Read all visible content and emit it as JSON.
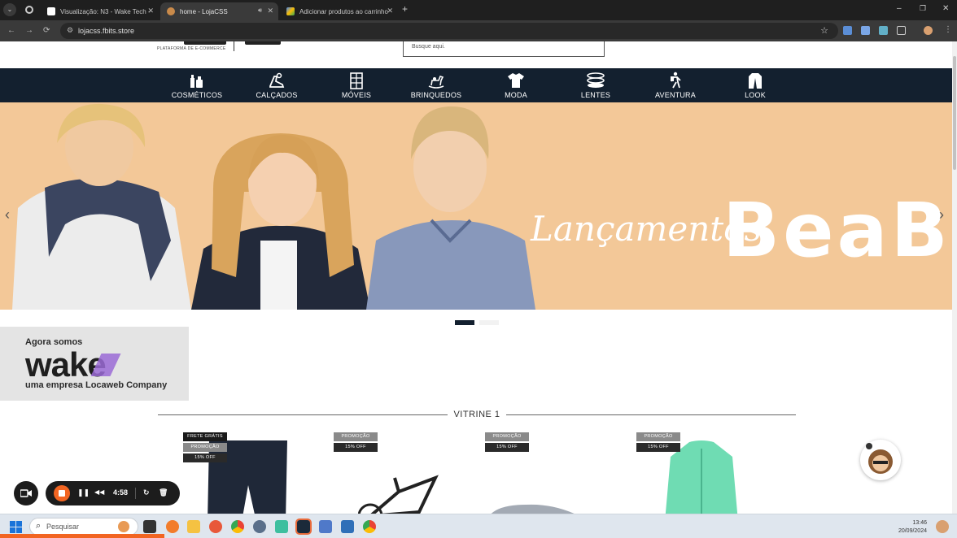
{
  "browser": {
    "tabs": [
      {
        "title": "Visualização: N3 - Wake Tech -",
        "active": false
      },
      {
        "title": "home - LojaCSS",
        "active": true
      },
      {
        "title": "Adicionar produtos ao carrinho",
        "active": false
      }
    ],
    "new_tab": "+",
    "address": "lojacss.fbits.store",
    "window_controls": [
      "–",
      "❐",
      "✕"
    ]
  },
  "page": {
    "logo_subtitle": "PLATAFORMA DE E-COMMERCE",
    "search_placeholder": "Busque aqui.",
    "categories": [
      {
        "label": "COSMÉTICOS",
        "icon": "cosmetics-icon"
      },
      {
        "label": "CALÇADOS",
        "icon": "shoe-icon"
      },
      {
        "label": "MÓVEIS",
        "icon": "furniture-icon"
      },
      {
        "label": "BRINQUEDOS",
        "icon": "rocking-horse-icon"
      },
      {
        "label": "MODA",
        "icon": "shirt-icon"
      },
      {
        "label": "LENTES",
        "icon": "lenses-icon"
      },
      {
        "label": "AVENTURA",
        "icon": "hiker-icon"
      },
      {
        "label": "LOOK",
        "icon": "jacket-icon"
      }
    ],
    "hero": {
      "script_text": "Lançamentos",
      "brand_text": "BeaB",
      "prev": "‹",
      "next": "›"
    },
    "wake_banner": {
      "line1": "Agora somos",
      "logo": "wake",
      "line3": "uma empresa Locaweb Company"
    },
    "vitrine_title": "VITRINE 1",
    "products": [
      {
        "badges": [
          "FRETE GRÁTIS",
          "PROMOÇÃO",
          "15% OFF"
        ]
      },
      {
        "badges": [
          "PROMOÇÃO",
          "15% OFF"
        ]
      },
      {
        "badges": [
          "PROMOÇÃO",
          "15% OFF"
        ]
      },
      {
        "badges": [
          "PROMOÇÃO",
          "15% OFF"
        ]
      }
    ]
  },
  "recorder": {
    "time": "4:58"
  },
  "taskbar": {
    "search_placeholder": "Pesquisar",
    "time": "13:46",
    "date": "20/09/2024"
  },
  "colors": {
    "nav_bg": "#13202f",
    "hero_bg": "#f3c898",
    "recorder_accent": "#f26522"
  }
}
